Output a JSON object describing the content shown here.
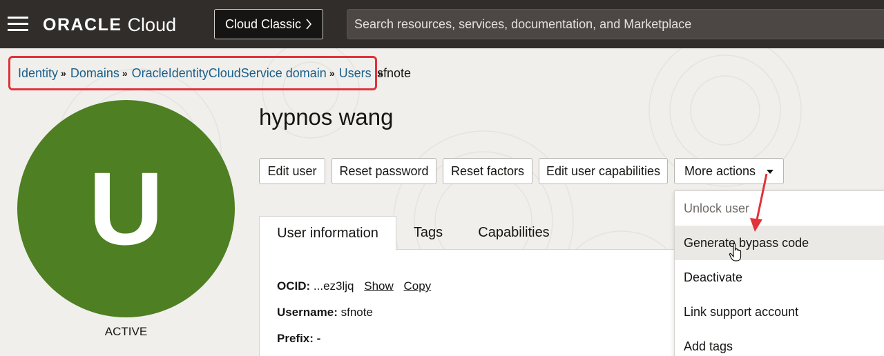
{
  "header": {
    "logo_oracle": "ORACLE",
    "logo_cloud": "Cloud",
    "classic_button": "Cloud Classic",
    "search_placeholder": "Search resources, services, documentation, and Marketplace"
  },
  "breadcrumb": {
    "items": [
      "Identity",
      "Domains",
      "OracleIdentityCloudService domain",
      "Users"
    ],
    "separator": "»",
    "current": "sfnote"
  },
  "user": {
    "name": "hypnos wang",
    "avatar_letter": "U",
    "status": "ACTIVE"
  },
  "actions": {
    "edit_user": "Edit user",
    "reset_password": "Reset password",
    "reset_factors": "Reset factors",
    "edit_capabilities": "Edit user capabilities",
    "more_actions": "More actions"
  },
  "tabs": {
    "user_information": "User information",
    "tags": "Tags",
    "capabilities": "Capabilities"
  },
  "info": {
    "ocid_label": "OCID:",
    "ocid_value": "...ez3ljq",
    "show": "Show",
    "copy": "Copy",
    "username_label": "Username:",
    "username_value": "sfnote",
    "prefix_label": "Prefix:",
    "prefix_value": "-"
  },
  "dropdown": {
    "items": [
      "Unlock user",
      "Generate bypass code",
      "Deactivate",
      "Link support account",
      "Add tags"
    ]
  },
  "colors": {
    "header_bg": "#312d2a",
    "avatar_bg": "#4e7f22",
    "link": "#1a5f8a",
    "highlight_border": "#e0323a"
  }
}
